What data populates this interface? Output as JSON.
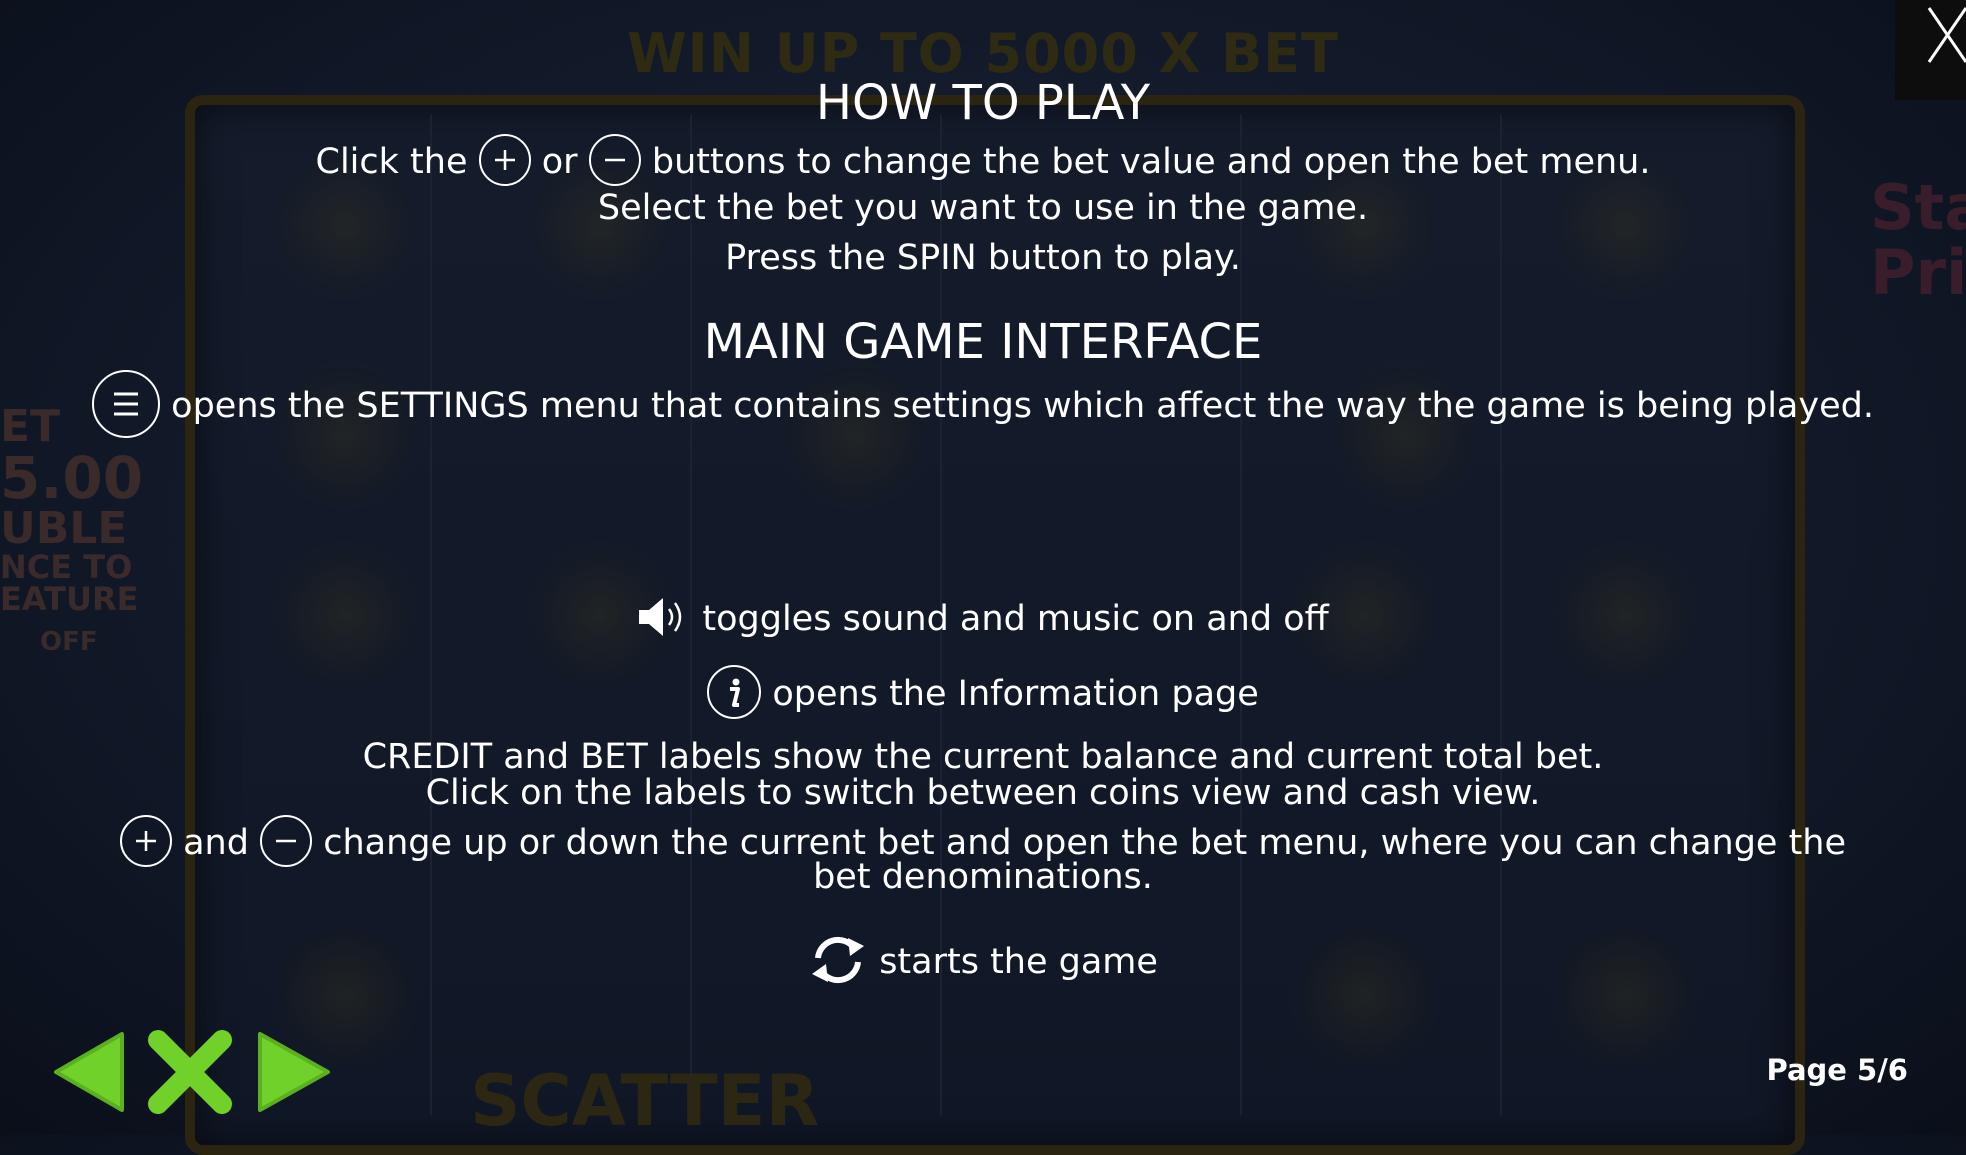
{
  "background": {
    "headline": "WIN UP TO 5000 X BET",
    "side_text": [
      "ET",
      "5.00",
      "UBLE",
      "NCE TO",
      "EATURE"
    ],
    "side_toggle": "OFF",
    "right_title": [
      "Star",
      "Prin"
    ],
    "scatter": "SCATTER"
  },
  "how_to_play": {
    "title": "HOW TO PLAY",
    "line1_a": "Click the",
    "line1_b": "or",
    "line1_c": "buttons to change the bet value and open the bet menu.",
    "line2": "Select the bet you want to use in the game.",
    "line3": "Press the SPIN button to play."
  },
  "interface": {
    "title": "MAIN GAME INTERFACE",
    "settings_text": "opens the SETTINGS menu that contains settings which affect the way the game is being played.",
    "sound_text": "toggles sound and music on and off",
    "info_text": "opens the Information page",
    "credit_line1": "CREDIT and BET labels show the current balance and current total bet.",
    "credit_line2": "Click on the labels to switch between coins view and cash view.",
    "plusminus_a": "and",
    "plusminus_b": "change up or down the current bet and open the bet menu, where you can change the",
    "plusminus_c": "bet denominations.",
    "spin_text": "starts the game"
  },
  "footer": {
    "page": "Page 5/6"
  },
  "colors": {
    "nav_green": "#6fd12a",
    "text": "#ffffff"
  }
}
